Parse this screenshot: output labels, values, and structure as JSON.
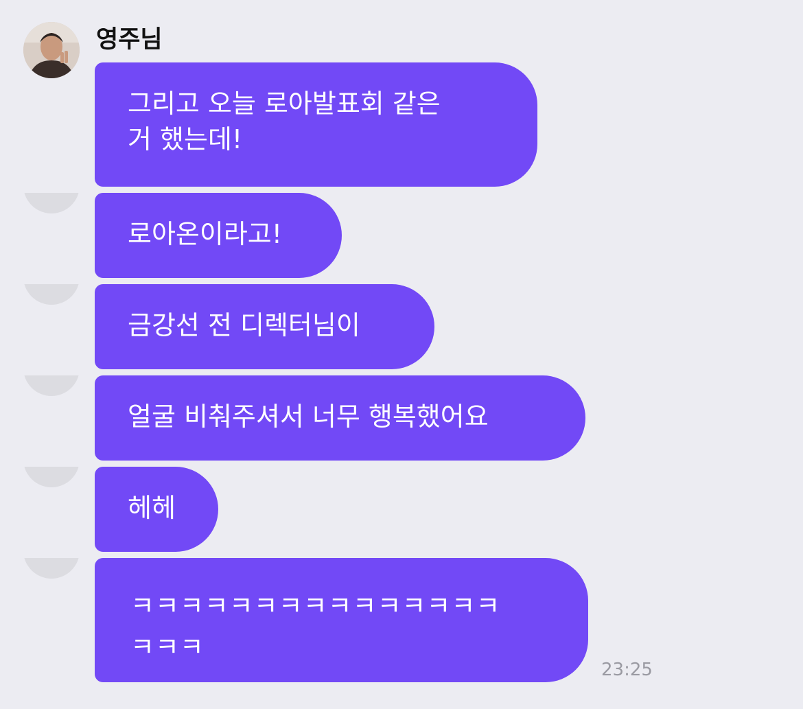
{
  "sender": {
    "name": "영주님"
  },
  "messages": [
    {
      "text": "그리고 오늘 로아발표회 같은\n거 했는데!"
    },
    {
      "text": "로아온이라고!"
    },
    {
      "text": "금강선 전 디렉터님이"
    },
    {
      "text": "얼굴 비춰주셔서 너무 행복했어요"
    },
    {
      "text": "헤헤"
    },
    {
      "text": "ㅋㅋㅋㅋㅋㅋㅋㅋㅋㅋㅋㅋㅋㅋㅋ\nㅋㅋㅋ"
    }
  ],
  "timestamp": "23:25",
  "colors": {
    "background": "#ececf2",
    "bubble": "#7249f6",
    "bubble_text": "#ffffff",
    "timestamp": "#9a9aa2"
  }
}
